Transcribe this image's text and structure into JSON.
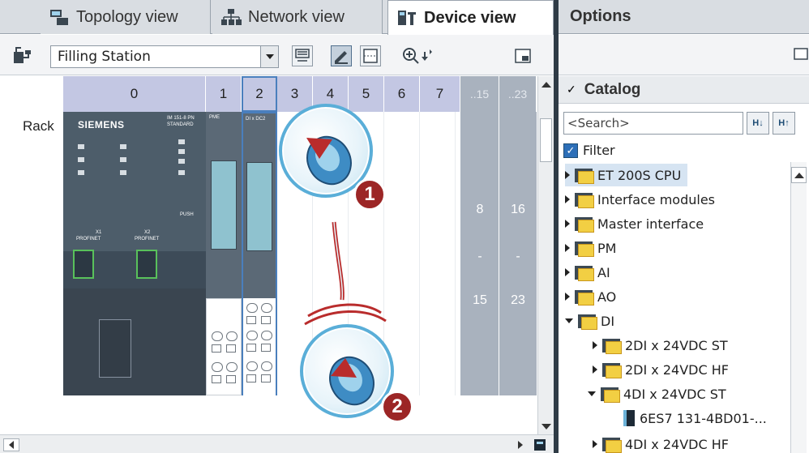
{
  "tabs": [
    {
      "label": "Topology view",
      "icon": "topology-icon"
    },
    {
      "label": "Network view",
      "icon": "network-icon"
    },
    {
      "label": "Device view",
      "icon": "device-icon"
    }
  ],
  "toolbar": {
    "device_select": "Filling Station"
  },
  "rack": {
    "label": "Rack",
    "slots": [
      "0",
      "1",
      "2",
      "3",
      "4",
      "5",
      "6",
      "7",
      "..15",
      "..23"
    ],
    "range_a": {
      "from": "8",
      "dash": "-",
      "to": "15"
    },
    "range_b": {
      "from": "16",
      "dash": "-",
      "to": "23"
    },
    "module0": {
      "brand": "SIEMENS",
      "model_line1": "IM 151-8 PN",
      "model_line2": "STANDARD",
      "x1": "X1",
      "x1b": "PROFINET",
      "x2": "X2",
      "x2b": "PROFINET",
      "push": "PUSH"
    },
    "slot1_label": "PME",
    "slot2_label": "DI x DC2"
  },
  "options": {
    "title": "Options",
    "catalog_title": "Catalog",
    "search_placeholder": "<Search>",
    "filter_label": "Filter"
  },
  "tree": [
    {
      "label": "ET 200S CPU",
      "expanded": false,
      "level": 0
    },
    {
      "label": "Interface modules",
      "expanded": false,
      "level": 0
    },
    {
      "label": "Master interface",
      "expanded": false,
      "level": 0
    },
    {
      "label": "PM",
      "expanded": false,
      "level": 0
    },
    {
      "label": "AI",
      "expanded": false,
      "level": 0
    },
    {
      "label": "AO",
      "expanded": false,
      "level": 0
    },
    {
      "label": "DI",
      "expanded": true,
      "level": 0
    },
    {
      "label": "2DI x 24VDC ST",
      "expanded": false,
      "level": 1
    },
    {
      "label": "2DI x 24VDC HF",
      "expanded": false,
      "level": 1
    },
    {
      "label": "4DI x 24VDC ST",
      "expanded": true,
      "level": 1
    },
    {
      "label": "6ES7 131-4BD01-...",
      "level": 2
    },
    {
      "label": "4DI x 24VDC HF",
      "expanded": false,
      "level": 1
    }
  ],
  "steps": [
    "1",
    "2"
  ],
  "colors": {
    "accent": "#5aaed8",
    "badge": "#9c2626",
    "slot_header": "#c3c7e3"
  }
}
